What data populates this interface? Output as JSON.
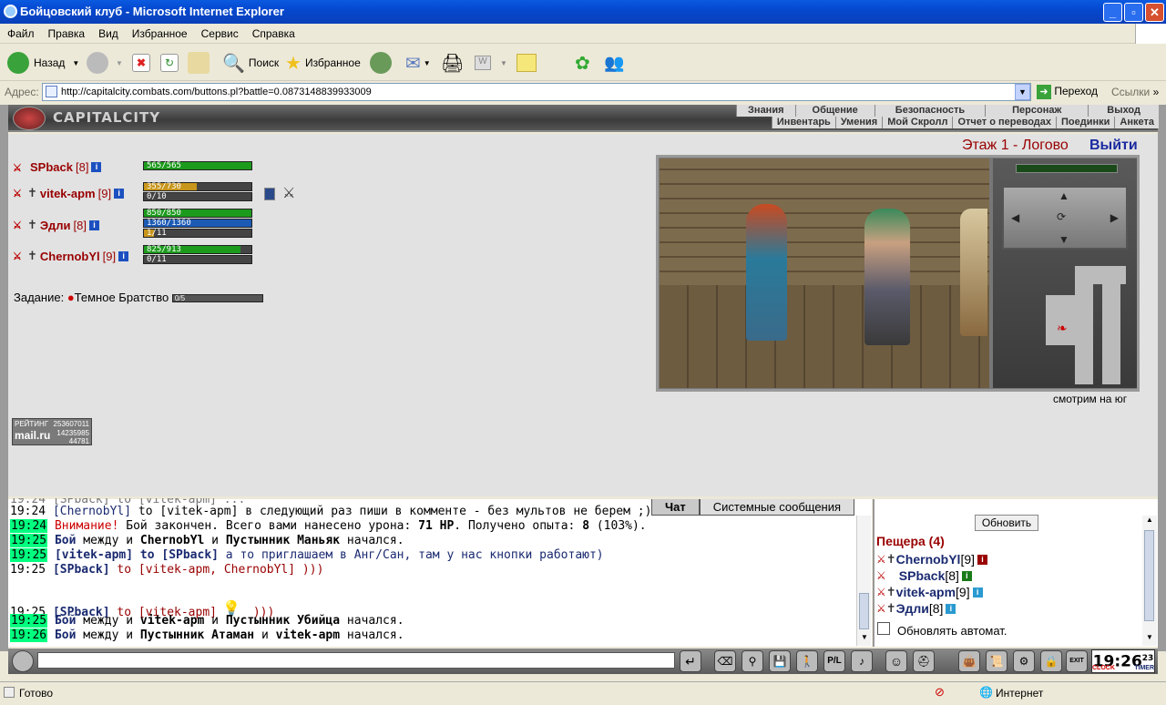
{
  "window": {
    "title": "Бойцовский клуб - Microsoft Internet Explorer"
  },
  "menu": [
    "Файл",
    "Правка",
    "Вид",
    "Избранное",
    "Сервис",
    "Справка"
  ],
  "toolbar": {
    "back_label": "Назад",
    "search_label": "Поиск",
    "favorites_label": "Избранное"
  },
  "address": {
    "label": "Адрес:",
    "url": "http://capitalcity.combats.com/buttons.pl?battle=0.0873148839933009",
    "go_label": "Переход",
    "links_label": "Ссылки"
  },
  "game": {
    "logo": "CAPITALCITY",
    "nav_top": [
      "Знания",
      "Общение",
      "Безопасность",
      "Персонаж",
      "Выход"
    ],
    "nav_bottom": [
      "Инвентарь",
      "Умения",
      "Мой Скролл",
      "Отчет о переводах",
      "Поединки",
      "Анкета"
    ],
    "floor": "Этаж 1 - Логово",
    "exit": "Выйти",
    "look": "смотрим на юг",
    "task_label": "Задание:",
    "task_name": "Темное Братство",
    "task_progress": "0/5",
    "rating": {
      "label": "РЕЙТИНГ",
      "brand": "mail.ru",
      "n1": "253607011",
      "n2": "14235985",
      "n3": "44781"
    },
    "party": [
      {
        "name": "SPback",
        "level": "[8]",
        "hp": "565/565",
        "hp_frac": 1.0
      },
      {
        "name": "vitek-apm",
        "level": "[9]",
        "hp": "355/730",
        "hp_frac": 0.49,
        "mana": "0/10"
      },
      {
        "name": "Эдли",
        "level": "[8]",
        "hp": "850/850",
        "hp_frac": 1.0,
        "mana": "1360/1360",
        "extra": "1/11"
      },
      {
        "name": "ChernobYl",
        "level": "[9]",
        "hp": "825/913",
        "hp_frac": 0.9,
        "mana": "0/11"
      }
    ]
  },
  "chat": {
    "tabs": [
      "Чат",
      "Системные сообщения"
    ],
    "lines": [
      {
        "time": "19:24",
        "pre": "[ChernobYl]",
        "text": " to [vitek-apm] в следующий раз пиши в комменте - без мультов не берем ;)"
      },
      {
        "time": "19:24",
        "warn": "Внимание!",
        "text": " Бой закончен. Всего вами нанесено урона: ",
        "b1": "71 HP",
        "t2": ". Получено опыта: ",
        "b2": "8",
        "t3": " (103%)."
      },
      {
        "time": "19:25",
        "b0": "Бой",
        "text": " между и ",
        "b1": "ChernobYl",
        "t2": " и ",
        "b2": "Пустынник Маньяк",
        "t3": " начался."
      },
      {
        "time": "19:25",
        "pre": "[vitek-apm] to [SPback]",
        "text": " а то приглашаем в Анг/Сан, там у нас кнопки работают)"
      },
      {
        "time": "19:25",
        "pre": "[SPback]",
        "text": " to [vitek-apm, ChernobYl] )))"
      },
      {
        "time": "19:25",
        "pre": "[SPback]",
        "text": " to [vitek-apm]",
        "tail": " )))"
      },
      {
        "time": "19:25",
        "b0": "Бой",
        "text": " между и ",
        "b1": "vitek-apm",
        "t2": " и ",
        "b2": "Пустынник Убийца",
        "t3": " начался."
      },
      {
        "time": "19:26",
        "b0": "Бой",
        "text": " между и ",
        "b1": "Пустынник Атаман",
        "t2": " и ",
        "b2": "vitek-apm",
        "t3": " начался."
      }
    ]
  },
  "room": {
    "refresh": "Обновить",
    "title": "Пещера (4)",
    "users": [
      {
        "name": "ChernobYl",
        "level": "[9]"
      },
      {
        "name": "SPback",
        "level": "[8]"
      },
      {
        "name": "vitek-apm",
        "level": "[9]"
      },
      {
        "name": "Эдли",
        "level": "[8]"
      }
    ],
    "auto_label": "Обновлять автомат."
  },
  "clock": {
    "time": "19:26",
    "sec": "23",
    "label1": "CLOCK",
    "label2": "TIMER"
  },
  "status": {
    "text": "Готово",
    "zone": "Интернет"
  }
}
